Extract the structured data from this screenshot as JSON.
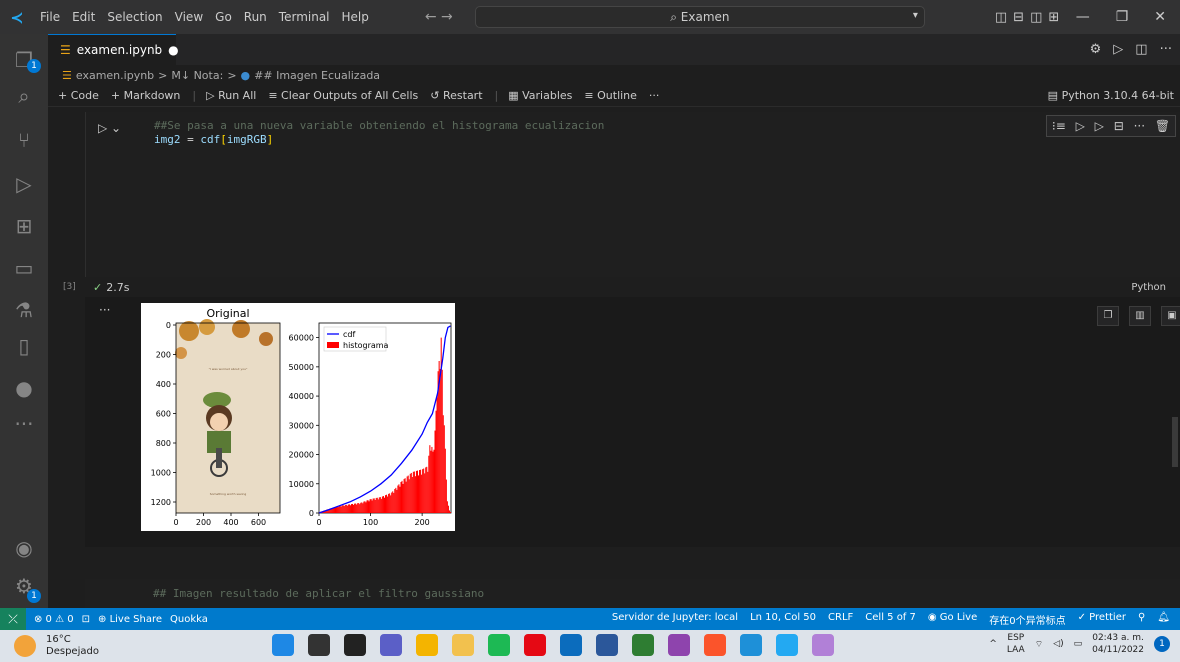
{
  "menu": [
    "File",
    "Edit",
    "Selection",
    "View",
    "Go",
    "Run",
    "Terminal",
    "Help"
  ],
  "search": {
    "text": "Examen"
  },
  "tab": {
    "title": "examen.ipynb",
    "modified_dot": "●"
  },
  "breadcrumb": {
    "file": "examen.ipynb",
    "sep": ">",
    "section": "M↓ Nota:",
    "item": "## Imagen Ecualizada"
  },
  "notebook_toolbar": {
    "code": "+ Code",
    "markdown": "+ Markdown",
    "run_all": "▷ Run All",
    "clear": "≡ Clear Outputs of All Cells",
    "restart": "↺ Restart",
    "variables": "▦ Variables",
    "outline": "≡ Outline",
    "more": "···",
    "kernel": "Python 3.10.4 64-bit"
  },
  "cell1": {
    "line1": "##Se pasa a una nueva variable obteniendo el histograma ecualizacion",
    "line2_var": "img2",
    "line2_op": " = ",
    "line2_fn": "cdf",
    "line2_open": "[",
    "line2_arg": "imgRGB",
    "line2_close": "]",
    "exec_count": "[3]",
    "exec_time": "2.7s",
    "language": "Python"
  },
  "cell2": {
    "line1": "## Imagen resultado de aplicar el filtro gaussiano"
  },
  "chart_data": [
    {
      "type": "image",
      "title": "Original",
      "yticks": [
        "0",
        "200",
        "400",
        "600",
        "800",
        "1000",
        "1200"
      ],
      "xticks": [
        "0",
        "200",
        "400",
        "600"
      ],
      "image_text": [
        "\"I was worried about you\"",
        "Something worth saving"
      ]
    },
    {
      "type": "line",
      "title": "",
      "xlabel": "",
      "ylabel": "",
      "xlim": [
        0,
        256
      ],
      "ylim": [
        0,
        65000
      ],
      "xticks": [
        "0",
        "100",
        "200"
      ],
      "yticks": [
        "0",
        "10000",
        "20000",
        "30000",
        "40000",
        "50000",
        "60000"
      ],
      "legend": {
        "placement": "upper-left",
        "entries": [
          "cdf",
          "histograma"
        ]
      },
      "series": [
        {
          "name": "cdf",
          "color": "#0000ff",
          "x": [
            0,
            20,
            40,
            60,
            80,
            100,
            120,
            140,
            160,
            180,
            200,
            210,
            220,
            230,
            240,
            245,
            250,
            255
          ],
          "values": [
            0,
            1200,
            2500,
            3800,
            5500,
            7500,
            10000,
            13000,
            17000,
            21500,
            27000,
            31000,
            34000,
            41000,
            53000,
            60000,
            63500,
            64000
          ]
        },
        {
          "name": "histograma",
          "color": "#ff0000",
          "x": [
            0,
            20,
            40,
            60,
            80,
            100,
            120,
            140,
            160,
            180,
            200,
            210,
            215,
            220,
            225,
            228,
            232,
            236,
            240,
            244,
            248,
            252,
            255
          ],
          "values": [
            300,
            1500,
            2500,
            3000,
            3500,
            4800,
            5500,
            7000,
            11000,
            14000,
            15000,
            16000,
            25000,
            21000,
            30000,
            45000,
            52000,
            60000,
            38000,
            22000,
            4000,
            1000,
            0
          ]
        }
      ]
    }
  ],
  "statusbar": {
    "errors": "⊗ 0 ⚠ 0",
    "liveshare": "Live Share",
    "quokka": "Quokka",
    "jupyter": "Servidor de Jupyter: local",
    "position": "Ln 10, Col 50",
    "eol": "CRLF",
    "cell": "Cell 5 of 7",
    "golive": "Go Live",
    "cjk": "存在0个异常标点",
    "prettier": "✓ Prettier"
  },
  "taskbar": {
    "temp": "16°C",
    "weather": "Despejado",
    "lang": "ESP",
    "lang2": "LAA",
    "time": "02:43 a. m.",
    "date": "04/11/2022",
    "notif_count": "1",
    "apps": [
      "windows-start",
      "search",
      "task-view",
      "teams-chat",
      "chrome",
      "file-explorer",
      "spotify",
      "netflix",
      "mail",
      "word",
      "photos",
      "browser-pink",
      "brave",
      "edge",
      "vscode",
      "visual-studio"
    ]
  },
  "activity_badge": "1",
  "colors": {
    "accent": "#0078d4",
    "statusbar": "#007acc",
    "cdf": "#0000ff",
    "hist": "#ff0000"
  }
}
